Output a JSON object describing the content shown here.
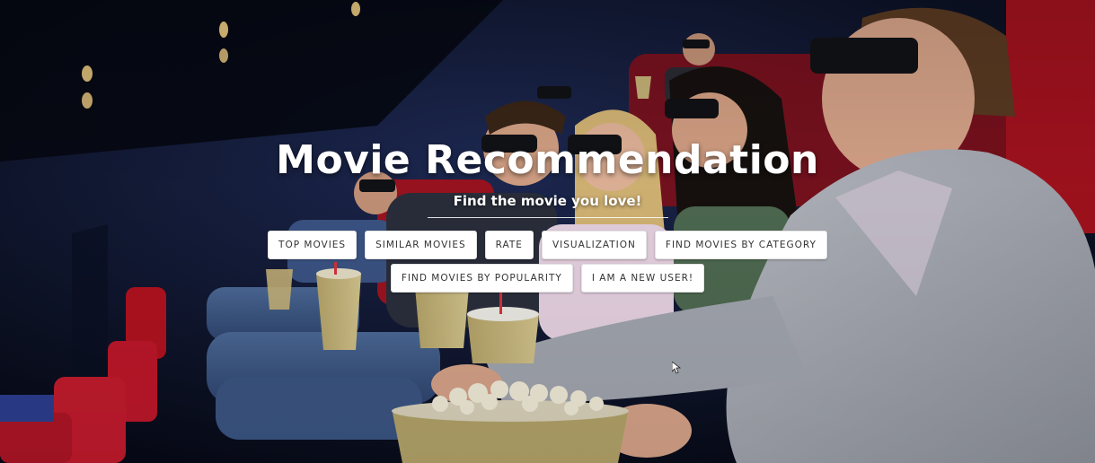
{
  "hero": {
    "title": "Movie Recommendation",
    "subtitle": "Find the movie you love!",
    "background_description_icon": "cinema-audience-3d-glasses-image"
  },
  "nav": {
    "row1": [
      "TOP MOVIES",
      "SIMILAR MOVIES",
      "RATE",
      "VISUALIZATION",
      "FIND MOVIES BY CATEGORY"
    ],
    "row2": [
      "FIND MOVIES BY POPULARITY",
      "I AM A NEW USER!"
    ]
  },
  "colors": {
    "button_bg": "#ffffff",
    "button_text": "#333333",
    "title_text": "#ffffff",
    "seat_red": "#b3121f",
    "theater_wall": "#141b3a"
  }
}
